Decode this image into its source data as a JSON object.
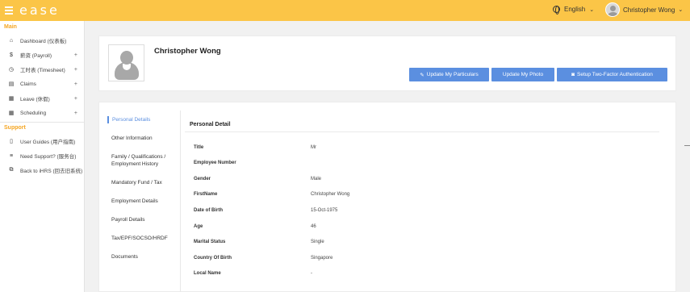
{
  "header": {
    "logo": "ease",
    "language": "English",
    "user_name": "Christopher Wong"
  },
  "sidebar": {
    "main_title": "Main",
    "main_items": [
      {
        "label": "Dashboard (仪表板)",
        "icon": "home-icon",
        "expandable": false
      },
      {
        "label": "薪资 (Payroll)",
        "icon": "dollar-icon",
        "expandable": true
      },
      {
        "label": "工时表 (Timesheet)",
        "icon": "clock-icon",
        "expandable": true
      },
      {
        "label": "Claims",
        "icon": "receipt-icon",
        "expandable": true
      },
      {
        "label": "Leave (休假)",
        "icon": "calendar-icon",
        "expandable": true
      },
      {
        "label": "Scheduling",
        "icon": "calendar-icon",
        "expandable": true
      }
    ],
    "support_title": "Support",
    "support_items": [
      {
        "label": "User Guides (用户指南)",
        "icon": "book-icon"
      },
      {
        "label": "Need Support? (服务台)",
        "icon": "menu-icon"
      },
      {
        "label": "Back to iHRS (回去旧系统)",
        "icon": "external-link-icon"
      }
    ],
    "expand_symbol": "+"
  },
  "profile": {
    "name": "Christopher Wong",
    "buttons": {
      "update_particulars": "Update My Particulars",
      "update_photo": "Update My Photo",
      "two_factor": "Setup Two-Factor Authentication"
    }
  },
  "tabs": [
    "Personal Details",
    "Other Information",
    "Family / Qualifications / Employment History",
    "Mandatory Fund / Tax",
    "Employment Details",
    "Payroll Details",
    "Tax/EPF/SOCSO/HRDF",
    "Documents"
  ],
  "personal_detail": {
    "heading": "Personal Detail",
    "rows": [
      {
        "label": "Title",
        "value": "Mr"
      },
      {
        "label": "Employee Number",
        "value": ""
      },
      {
        "label": "Gender",
        "value": "Male"
      },
      {
        "label": "FirstName",
        "value": "Christopher Wong"
      },
      {
        "label": "Date of Birth",
        "value": "15-Oct-1975"
      },
      {
        "label": "Age",
        "value": "46"
      },
      {
        "label": "Marital Status",
        "value": "Single"
      },
      {
        "label": "Country Of Birth",
        "value": "Singapore"
      },
      {
        "label": "Local Name",
        "value": "-"
      }
    ]
  },
  "colors": {
    "topbar": "#fbc547",
    "accent": "#5b8fe0",
    "section_title": "#f5a623"
  }
}
